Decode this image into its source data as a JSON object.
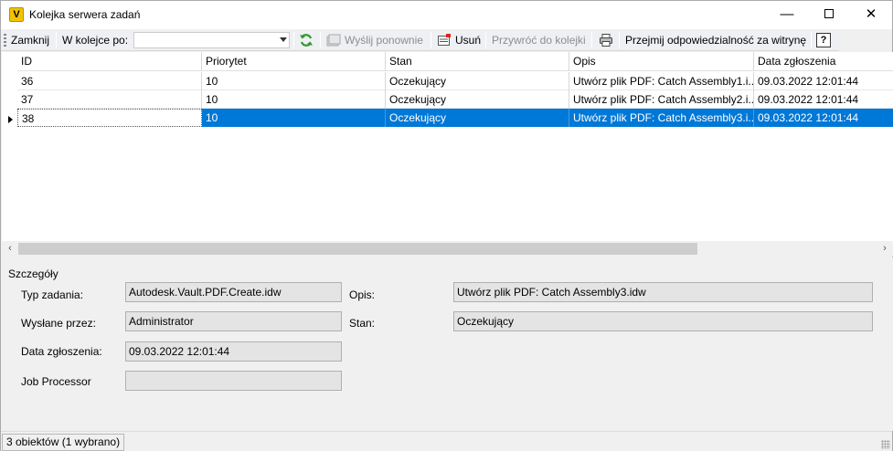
{
  "window": {
    "title": "Kolejka serwera zadań",
    "app_icon_letter": "V",
    "controls": {
      "minimize": "—",
      "close": "✕"
    }
  },
  "toolbar": {
    "close_label": "Zamknij",
    "queue_label": "W kolejce po:",
    "queue_value": "",
    "resend_label": "Wyślij ponownie",
    "delete_label": "Usuń",
    "restore_label": "Przywróć do kolejki",
    "ownership_label": "Przejmij odpowiedzialność za witrynę",
    "help_label": "?"
  },
  "grid": {
    "columns": [
      "ID",
      "Priorytet",
      "Stan",
      "Opis",
      "Data zgłoszenia"
    ],
    "rows": [
      {
        "id": "36",
        "priority": "10",
        "state": "Oczekujący",
        "description": "Utwórz plik PDF: Catch Assembly1.i...",
        "date": "09.03.2022 12:01:44",
        "selected": false
      },
      {
        "id": "37",
        "priority": "10",
        "state": "Oczekujący",
        "description": "Utwórz plik PDF: Catch Assembly2.i...",
        "date": "09.03.2022 12:01:44",
        "selected": false
      },
      {
        "id": "38",
        "priority": "10",
        "state": "Oczekujący",
        "description": "Utwórz plik PDF: Catch Assembly3.i...",
        "date": "09.03.2022 12:01:44",
        "selected": true
      }
    ]
  },
  "details": {
    "title": "Szczegóły",
    "job_type_label": "Typ zadania:",
    "job_type_value": "Autodesk.Vault.PDF.Create.idw",
    "sent_by_label": "Wysłane przez:",
    "sent_by_value": "Administrator",
    "date_label": "Data zgłoszenia:",
    "date_value": "09.03.2022 12:01:44",
    "processor_label": "Job Processor",
    "processor_value": "",
    "description_label": "Opis:",
    "description_value": "Utwórz plik PDF: Catch Assembly3.idw",
    "state_label": "Stan:",
    "state_value": "Oczekujący"
  },
  "status": {
    "text": "3 obiektów (1 wybrano)"
  },
  "colors": {
    "selection": "#0078d7",
    "toolbar_bg": "#eef0f3",
    "window_bg": "#f0f0f0"
  },
  "icons": [
    "app-vault-icon",
    "refresh-icon",
    "resend-icon",
    "delete-icon",
    "print-icon",
    "help-icon"
  ]
}
